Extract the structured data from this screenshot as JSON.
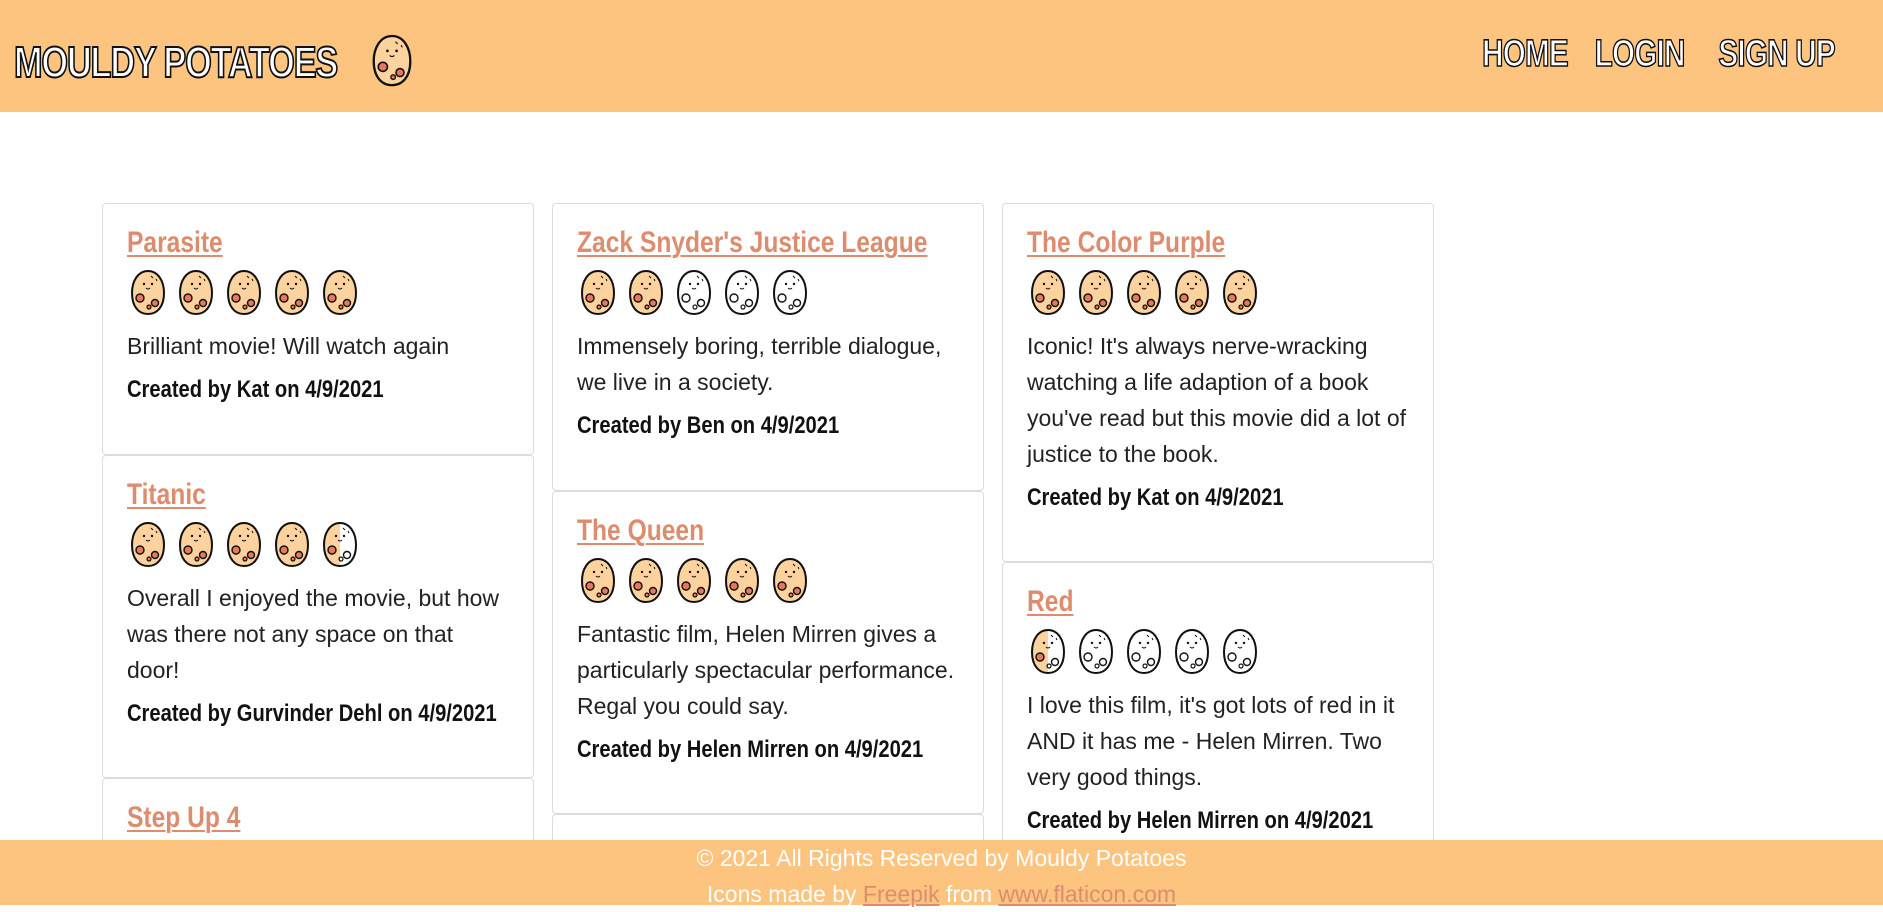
{
  "header": {
    "brand": "MOULDY POTATOES",
    "logo_icon": "potato-icon",
    "nav": [
      "HOME",
      "LOGIN",
      "SIGN UP"
    ]
  },
  "colors": {
    "header_bg": "#fdc47f",
    "title_link": "#dd8c6d",
    "potato_fill": "#fcd29e",
    "potato_blush": "#e7775e"
  },
  "columns": [
    [
      {
        "title": "Parasite",
        "rating": 5,
        "review": "Brilliant movie! Will watch again",
        "author": "Created by Kat on 4/9/2021"
      },
      {
        "title": "Titanic",
        "rating": 4.5,
        "review": "Overall I enjoyed the movie, but how was there not any space on that door!",
        "author": "Created by Gurvinder Dehl on 4/9/2021"
      },
      {
        "title": "Step Up 4",
        "rating": null,
        "review": "",
        "author": ""
      }
    ],
    [
      {
        "title": "Zack Snyder's Justice League",
        "rating": 2,
        "review": "Immensely boring, terrible dialogue, we live in a society.",
        "author": "Created by Ben on 4/9/2021"
      },
      {
        "title": "The Queen",
        "rating": 5,
        "review": "Fantastic film, Helen Mirren gives a particularly spectacular performance. Regal you could say.",
        "author": "Created by Helen Mirren on 4/9/2021"
      },
      {
        "title": "",
        "rating": null,
        "review": "",
        "author": ""
      }
    ],
    [
      {
        "title": "The Color Purple",
        "rating": 5,
        "review": "Iconic! It's always nerve-wracking watching a life adaption of a book you've read but this movie did a lot of justice to the book.",
        "author": "Created by Kat on 4/9/2021"
      },
      {
        "title": "Red",
        "rating": 0.5,
        "review": "I love this film, it's got lots of red in it AND it has me - Helen Mirren. Two very good things.",
        "author": "Created by Helen Mirren on 4/9/2021"
      }
    ]
  ],
  "footer": {
    "copyright": "© 2021 All Rights Reserved by Mouldy Potatoes",
    "credit_prefix": "Icons made by",
    "credit_author": "Freepik",
    "credit_mid": "from",
    "credit_site": "www.flaticon.com"
  }
}
